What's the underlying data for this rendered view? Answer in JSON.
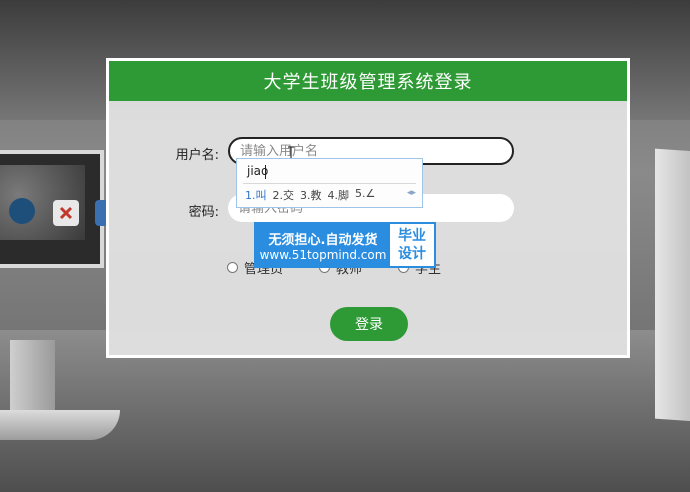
{
  "login": {
    "title": "大学生班级管理系统登录",
    "username_label": "用户名:",
    "username_placeholder": "请输入用户名",
    "password_label": "密码:",
    "password_placeholder": "请输入密码",
    "roles": [
      "管理员",
      "教师",
      "学生"
    ],
    "submit_label": "登录"
  },
  "ime": {
    "input": "jiao",
    "candidates": [
      "1.叫",
      "2.交",
      "3.教",
      "4.脚",
      "5.∠"
    ]
  },
  "ad": {
    "line1": "无须担心.自动发货",
    "line2": "www.51topmind.com",
    "badge_line1": "毕业",
    "badge_line2": "设计"
  },
  "colors": {
    "primary_green": "#2e9a35",
    "ad_blue": "#2b8de0"
  }
}
